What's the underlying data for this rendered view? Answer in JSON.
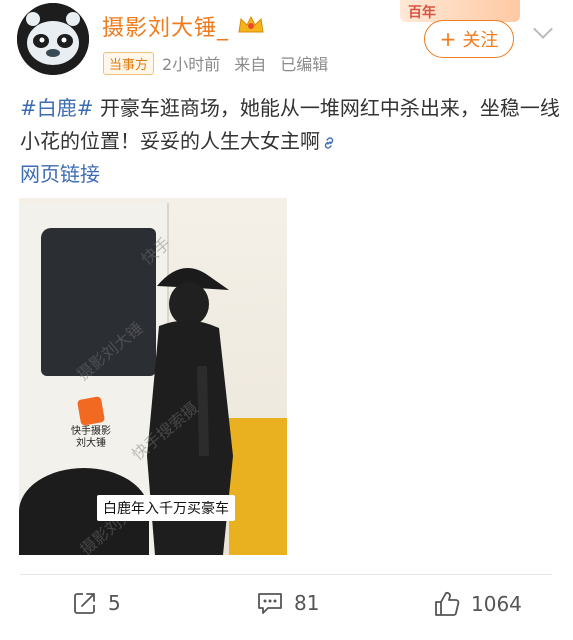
{
  "post": {
    "author": "摄影刘大锤_",
    "tag": "当事方",
    "time": "2小时前",
    "source_prefix": "来自",
    "edited": "已编辑",
    "hashtag": "#白鹿#",
    "text": " 开豪车逛商场，她能从一堆网红中杀出来，坐稳一线小花的位置！妥妥的人生大女主啊",
    "link_text": "网页链接"
  },
  "header": {
    "follow_label": "关注",
    "follow_plus": "+",
    "banner_text": "百年"
  },
  "image": {
    "caption": "白鹿年入千万买豪车",
    "logo_line1": "快手摄影",
    "logo_line2": "刘大锤",
    "watermark1": "快手",
    "watermark2": "摄影刘大锤",
    "watermark3": "快手搜索摄",
    "watermark4": "摄影刘大"
  },
  "actions": {
    "share_count": "5",
    "comment_count": "81",
    "like_count": "1064"
  },
  "colors": {
    "accent": "#f07b1d",
    "link": "#3e6cb2"
  }
}
